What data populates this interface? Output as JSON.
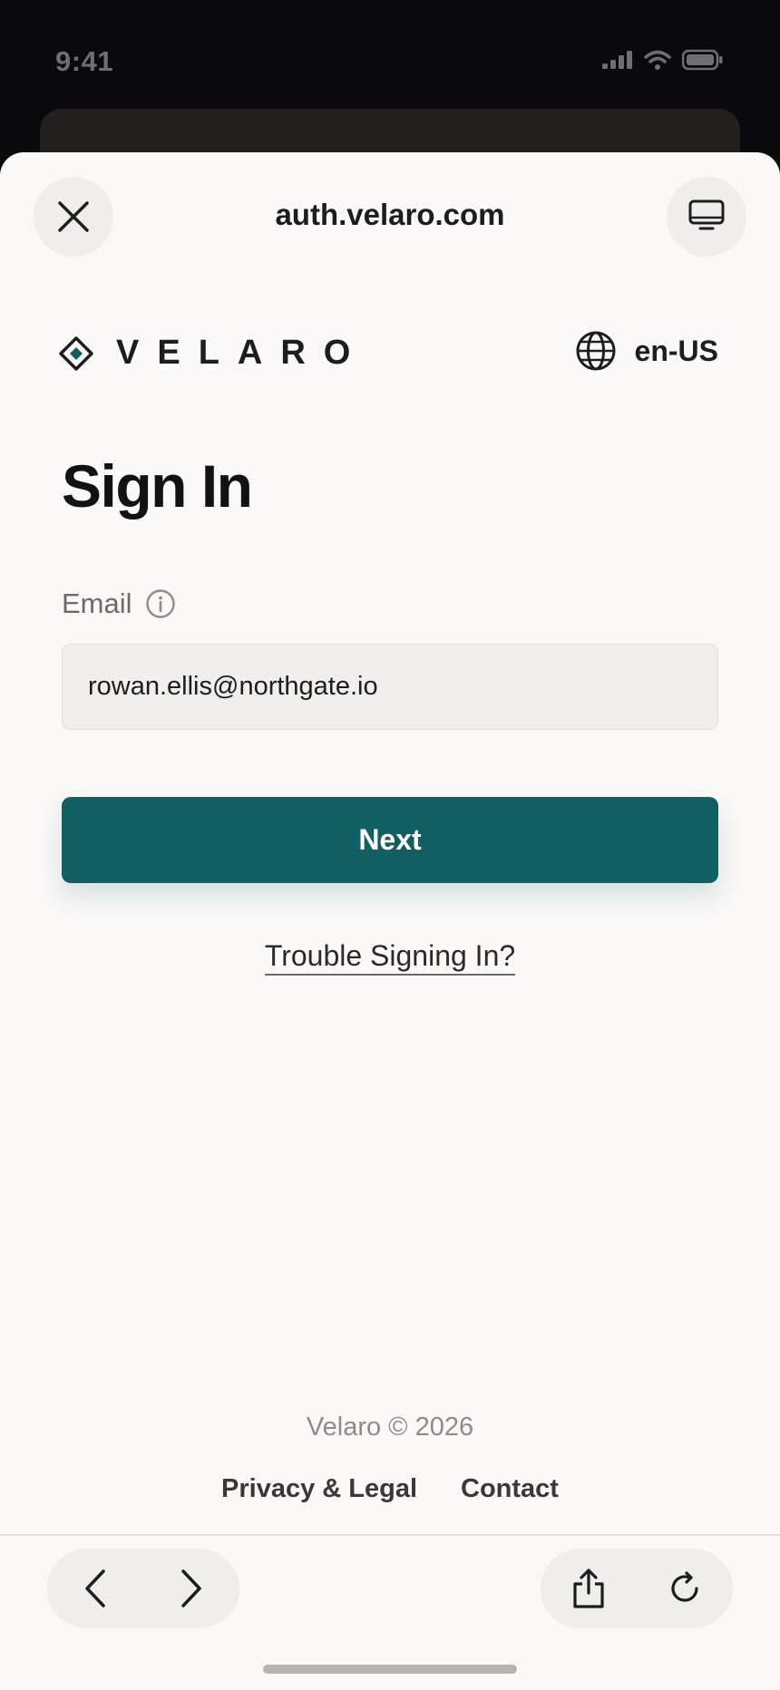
{
  "status_bar": {
    "time": "9:41",
    "icons": [
      "signal-icon",
      "wifi-icon",
      "battery-icon"
    ]
  },
  "browser": {
    "domain": "auth.velaro.com",
    "close_icon": "close-icon",
    "device_icon": "monitor-icon"
  },
  "brand": {
    "name": "VELARO",
    "logo_icon": "diamond-logo-icon",
    "accent_color": "#115e63"
  },
  "language": {
    "icon": "globe-icon",
    "label": "en-US"
  },
  "form": {
    "title": "Sign In",
    "email_label": "Email",
    "email_info_icon": "info-icon",
    "email_value": "rowan.ellis@northgate.io",
    "next_label": "Next",
    "trouble_link": "Trouble Signing In?"
  },
  "footer": {
    "copyright": "Velaro © 2026",
    "links": [
      "Privacy & Legal",
      "Contact"
    ]
  },
  "toolbar": {
    "back_icon": "chevron-left-icon",
    "forward_icon": "chevron-right-icon",
    "share_icon": "share-icon",
    "reload_icon": "reload-icon"
  }
}
